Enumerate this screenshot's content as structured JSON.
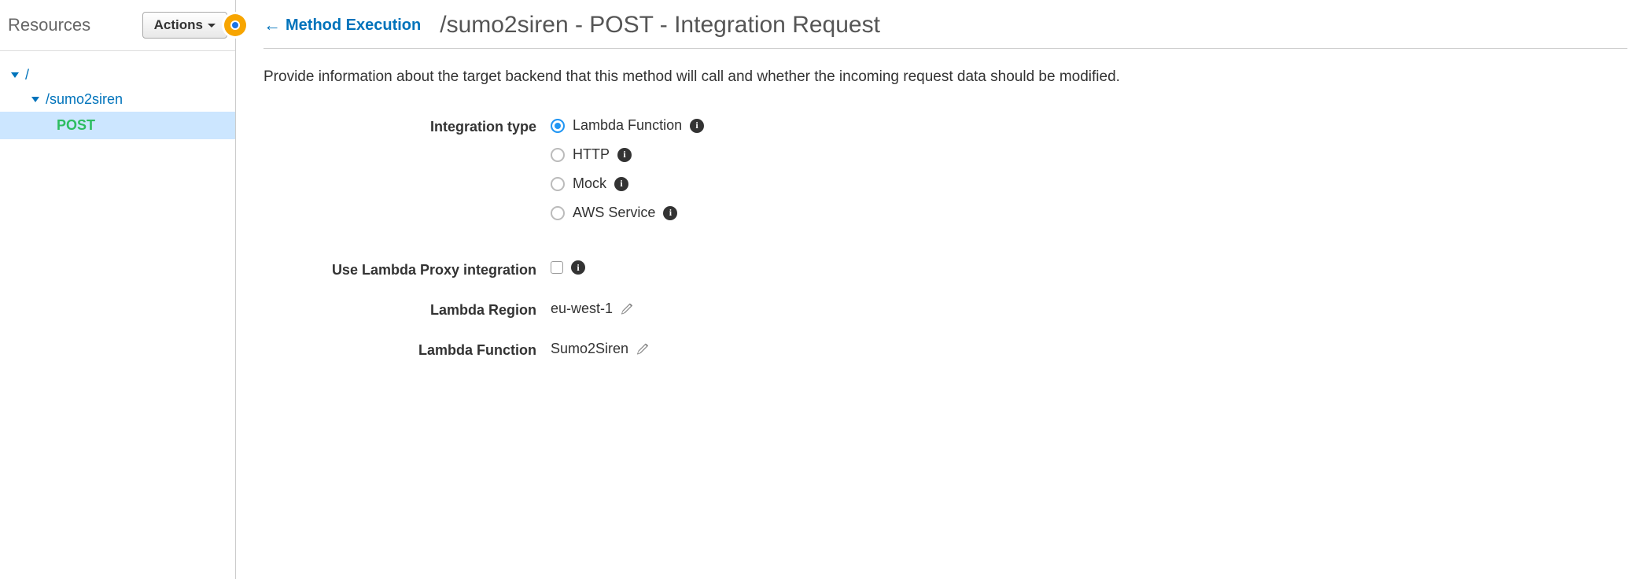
{
  "sidebar": {
    "title": "Resources",
    "actions_label": "Actions",
    "tree": {
      "root": "/",
      "resource": "/sumo2siren",
      "method": "POST"
    }
  },
  "header": {
    "back_label": "Method Execution",
    "page_title": "/sumo2siren - POST - Integration Request"
  },
  "description": "Provide information about the target backend that this method will call and whether the incoming request data should be modified.",
  "form": {
    "integration_type": {
      "label": "Integration type",
      "options": {
        "lambda": "Lambda Function",
        "http": "HTTP",
        "mock": "Mock",
        "aws": "AWS Service"
      },
      "selected": "lambda"
    },
    "proxy": {
      "label": "Use Lambda Proxy integration",
      "checked": false
    },
    "lambda_region": {
      "label": "Lambda Region",
      "value": "eu-west-1"
    },
    "lambda_function": {
      "label": "Lambda Function",
      "value": "Sumo2Siren"
    }
  }
}
